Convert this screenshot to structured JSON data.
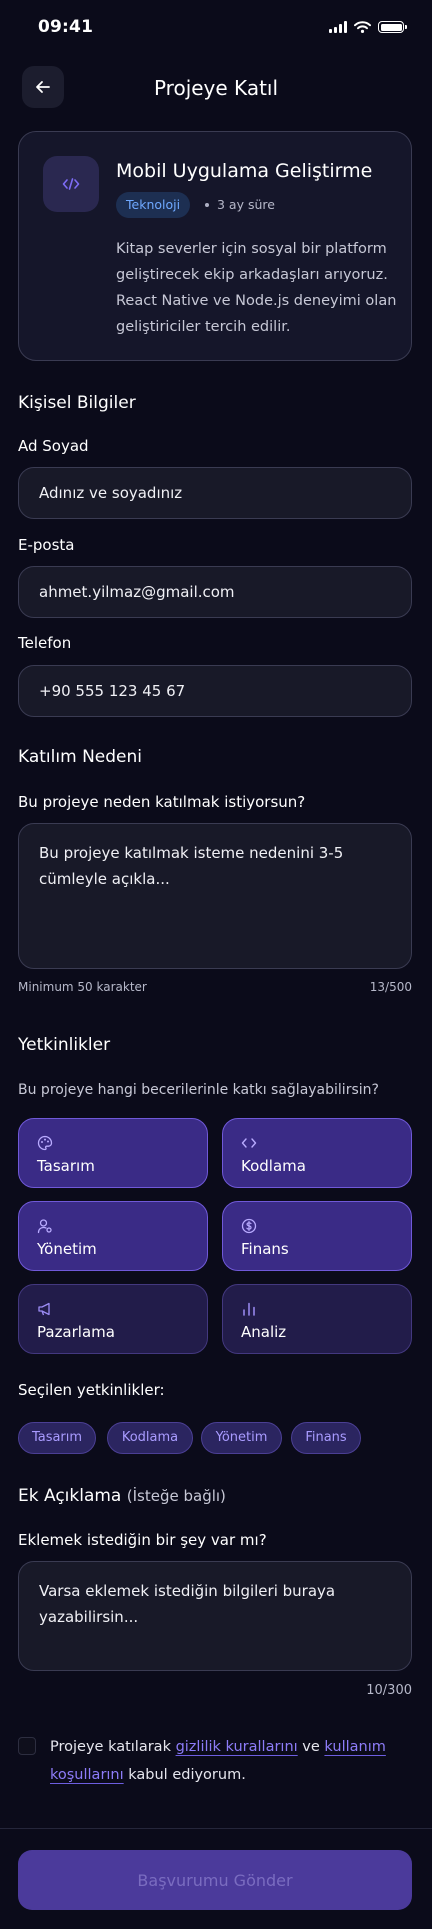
{
  "status_bar": {
    "time": "09:41"
  },
  "header": {
    "title": "Projeye Katıl",
    "back_icon": "arrow-left-icon"
  },
  "project": {
    "icon": "code-icon",
    "title": "Mobil Uygulama Geliştirme",
    "category": "Teknoloji",
    "duration": "3 ay süre",
    "description": "Kitap severler için sosyal bir platform geliştirecek ekip arkadaşları arıyoruz. React Native ve Node.js deneyimi olan geliştiriciler tercih edilir."
  },
  "personal": {
    "section_title": "Kişisel Bilgiler",
    "name_label": "Ad Soyad",
    "name_placeholder": "Adınız ve soyadınız",
    "email_label": "E-posta",
    "email_value": "ahmet.yilmaz@gmail.com",
    "phone_label": "Telefon",
    "phone_value": "+90 555 123 45 67"
  },
  "reason": {
    "section_title": "Katılım Nedeni",
    "question": "Bu projeye neden katılmak istiyorsun?",
    "placeholder": "Bu projeye katılmak isteme nedenini 3-5 cümleyle açıkla...",
    "hint": "Minimum 50 karakter",
    "counter": "13/500"
  },
  "skills": {
    "section_title": "Yetkinlikler",
    "question": "Bu projeye hangi becerilerinle katkı sağlayabilirsin?",
    "items": [
      {
        "label": "Tasarım",
        "icon": "palette-icon",
        "selected": true
      },
      {
        "label": "Kodlama",
        "icon": "code-icon",
        "selected": true
      },
      {
        "label": "Yönetim",
        "icon": "user-settings-icon",
        "selected": true
      },
      {
        "label": "Finans",
        "icon": "dollar-circle-icon",
        "selected": true
      },
      {
        "label": "Pazarlama",
        "icon": "megaphone-icon",
        "selected": false
      },
      {
        "label": "Analiz",
        "icon": "bar-chart-icon",
        "selected": false
      }
    ],
    "selected_title": "Seçilen yetkinlikler:",
    "selected_chips": [
      "Tasarım",
      "Kodlama",
      "Yönetim",
      "Finans"
    ]
  },
  "extra": {
    "section_title": "Ek Açıklama",
    "optional": "(İsteğe bağlı)",
    "question": "Eklemek istediğin bir şey var mı?",
    "placeholder": "Varsa eklemek istediğin bilgileri buraya yazabilirsin...",
    "counter": "10/300"
  },
  "terms": {
    "prefix": "Projeye katılarak ",
    "link1": "gizlilik kurallarını",
    "middle": " ve ",
    "link2": "kullanım koşullarını",
    "suffix": " kabul ediyorum."
  },
  "submit": {
    "label": "Başvurumu Gönder"
  },
  "colors": {
    "background": "#0b0b1a",
    "accent": "#7059d8",
    "tag_blue": "#6fa8ff",
    "link": "#8d7cf8"
  }
}
